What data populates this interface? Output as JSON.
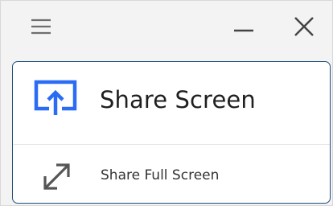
{
  "titlebar": {
    "menu_icon": "hamburger-menu-icon",
    "minimize_icon": "minimize-icon",
    "close_icon": "close-icon"
  },
  "share_menu": {
    "share_screen": {
      "label": "Share Screen",
      "icon": "screen-share-icon"
    },
    "share_full_screen": {
      "label": "Share Full Screen",
      "icon": "expand-arrows-icon"
    }
  },
  "colors": {
    "accent_blue": "#2a6df4",
    "panel_border": "#1f4f7a",
    "icon_gray": "#555555"
  }
}
